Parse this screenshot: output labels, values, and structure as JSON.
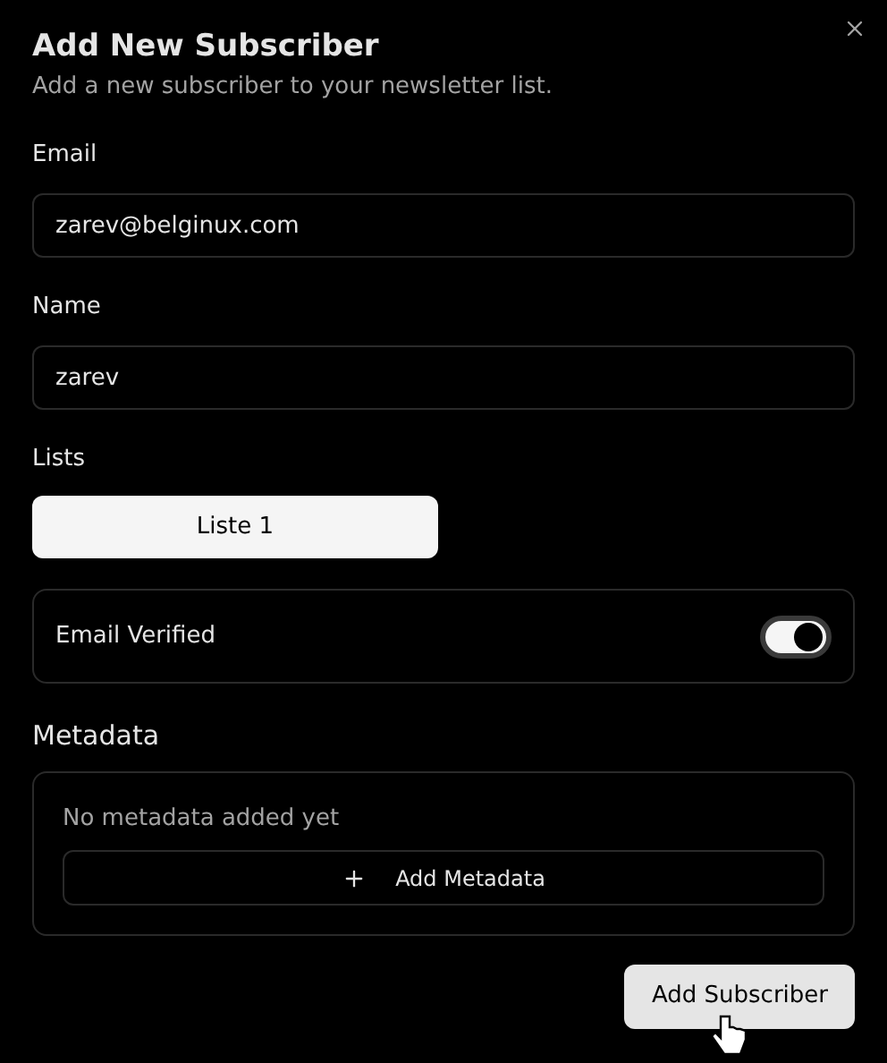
{
  "dialog": {
    "title": "Add New Subscriber",
    "description": "Add a new subscriber to your newsletter list."
  },
  "fields": [
    {
      "label": "Email",
      "value": "zarev@belginux.com"
    },
    {
      "label": "Name",
      "value": "zarev"
    }
  ],
  "lists": {
    "label": "Lists",
    "items": [
      {
        "label": "Liste 1",
        "selected": true
      }
    ]
  },
  "email_verified": {
    "label": "Email Verified",
    "on": true
  },
  "metadata": {
    "heading": "Metadata",
    "empty_text": "No metadata added yet",
    "add_button": "Add Metadata"
  },
  "submit_button": "Add Subscriber"
}
